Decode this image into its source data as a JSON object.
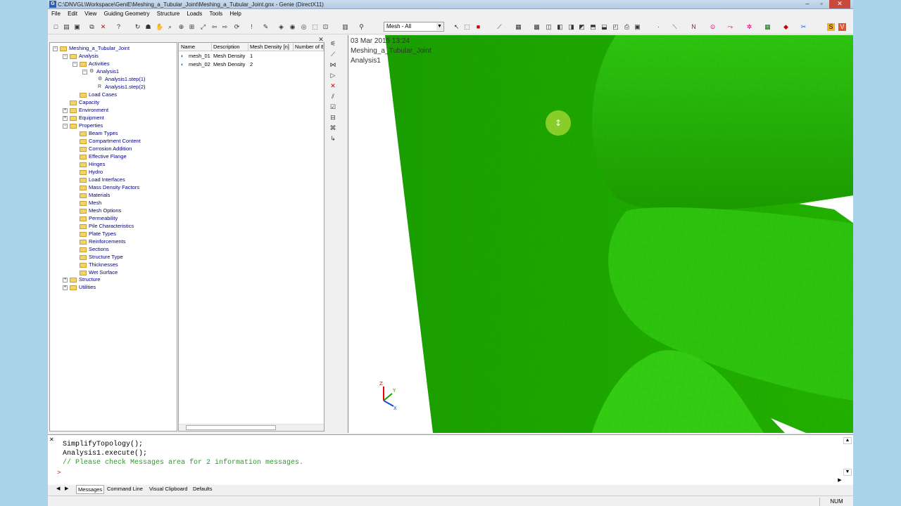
{
  "window": {
    "title": "C:\\DNVGL\\Workspace\\GeniE\\Meshing_a_Tubular_Joint\\Meshing_a_Tubular_Joint.gnx - Genie (DirectX11)"
  },
  "menu": [
    "File",
    "Edit",
    "View",
    "Guiding Geometry",
    "Structure",
    "Loads",
    "Tools",
    "Help"
  ],
  "toolbar": {
    "mesh_select": "Mesh - All"
  },
  "tree": {
    "root": "Meshing_a_Tubular_Joint",
    "analysis": "Analysis",
    "activities": "Activities",
    "analysis1": "Analysis1",
    "step1": "Analysis1.step(1)",
    "step2": "Analysis1.step(2)",
    "load_cases": "Load Cases",
    "capacity": "Capacity",
    "environment": "Environment",
    "equipment": "Equipment",
    "properties": "Properties",
    "property_items": [
      "Beam Types",
      "Compartment Content",
      "Corrosion Addition",
      "Effective Flange",
      "Hinges",
      "Hydro",
      "Load Interfaces",
      "Mass Density Factors",
      "Materials",
      "Mesh",
      "Mesh Options",
      "Permeability",
      "Pile Characteristics",
      "Plate Types",
      "Reinforcements",
      "Sections",
      "Structure Type",
      "Thicknesses",
      "Wet Surface"
    ],
    "structure": "Structure",
    "utilities": "Utilities"
  },
  "list": {
    "headers": [
      "Name",
      "Description",
      "Mesh Density [n]",
      "Number of E"
    ],
    "rows": [
      {
        "name": "mesh_01",
        "description": "Mesh Density",
        "density": "1"
      },
      {
        "name": "mesh_02",
        "description": "Mesh Density",
        "density": "2"
      }
    ]
  },
  "viewport": {
    "date": "03 Mar 2015 13:24",
    "model": "Meshing_a_Tubular_Joint",
    "analysis": "Analysis1",
    "mesh_color": "#22bb00"
  },
  "command": {
    "lines": [
      "SimplifyTopology();",
      "Analysis1.execute();",
      "// Please check Messages area for 2 information messages."
    ],
    "prompt": ">",
    "tabs": [
      "Messages",
      "Command Line",
      "Visual Clipboard",
      "Defaults"
    ]
  },
  "status": {
    "num": "NUM"
  }
}
